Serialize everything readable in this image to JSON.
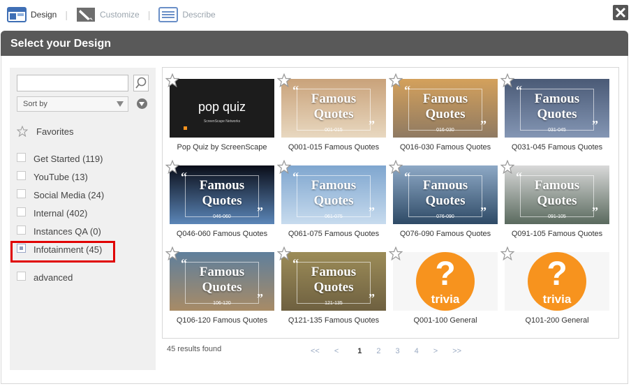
{
  "steps": [
    {
      "label": "Design",
      "icon": "layout-icon",
      "active": true
    },
    {
      "label": "Customize",
      "icon": "brush-icon",
      "active": false
    },
    {
      "label": "Describe",
      "icon": "describe-icon",
      "active": false
    }
  ],
  "header": {
    "title": "Select your Design"
  },
  "sidebar": {
    "search_placeholder": "",
    "sort_label": "Sort by",
    "favorites_label": "Favorites",
    "filters": [
      {
        "label": "Get Started (119)",
        "checked": false
      },
      {
        "label": "YouTube (13)",
        "checked": false
      },
      {
        "label": "Social Media (24)",
        "checked": false
      },
      {
        "label": "Internal (402)",
        "checked": false
      },
      {
        "label": "Instances QA (0)",
        "checked": false
      },
      {
        "label": "Infotainment (45)",
        "checked": true
      }
    ],
    "advanced_label": "advanced"
  },
  "designs": [
    {
      "caption": "Pop Quiz by ScreenScape",
      "kind": "popquiz",
      "thumb_title": "pop quiz",
      "thumb_sub": "ScreenScape Networks"
    },
    {
      "caption": "Q001-015 Famous Quotes",
      "kind": "quotes",
      "range": "001-015",
      "bg": [
        "#c9a27a",
        "#e8d8c0"
      ]
    },
    {
      "caption": "Q016-030 Famous Quotes",
      "kind": "quotes",
      "range": "016-030",
      "bg": [
        "#d4a15c",
        "#8f7a62"
      ]
    },
    {
      "caption": "Q031-045 Famous Quotes",
      "kind": "quotes",
      "range": "031-045",
      "bg": [
        "#4a5a76",
        "#8496b4"
      ]
    },
    {
      "caption": "Q046-060 Famous Quotes",
      "kind": "quotes",
      "range": "046-060",
      "bg": [
        "#0a0d18",
        "#5b86b8"
      ]
    },
    {
      "caption": "Q061-075 Famous Quotes",
      "kind": "quotes",
      "range": "061-075",
      "bg": [
        "#7fa6cf",
        "#c7dbee"
      ]
    },
    {
      "caption": "Q076-090 Famous Quotes",
      "kind": "quotes",
      "range": "076-090",
      "bg": [
        "#8ea9c6",
        "#2e4a66"
      ]
    },
    {
      "caption": "Q091-105 Famous Quotes",
      "kind": "quotes",
      "range": "091-105",
      "bg": [
        "#d9d9d9",
        "#5a6a5e"
      ]
    },
    {
      "caption": "Q106-120 Famous Quotes",
      "kind": "quotes",
      "range": "106-120",
      "bg": [
        "#5f7f9c",
        "#a88b66"
      ]
    },
    {
      "caption": "Q121-135 Famous Quotes",
      "kind": "quotes",
      "range": "121-135",
      "bg": [
        "#9c8c58",
        "#6e6040"
      ]
    },
    {
      "caption": "Q001-100 General",
      "kind": "trivia",
      "q": "?",
      "word": "trivia"
    },
    {
      "caption": "Q101-200 General",
      "kind": "trivia",
      "q": "?",
      "word": "trivia"
    }
  ],
  "quote_words": [
    "Famous",
    "Quotes"
  ],
  "results_text": "45 results found",
  "pagination": {
    "first": "<<",
    "prev": "<",
    "pages": [
      "1",
      "2",
      "3",
      "4"
    ],
    "current": "1",
    "next": ">",
    "last": ">>"
  },
  "colors": {
    "accent": "#f7931e",
    "highlight": "#e00000",
    "header_bg": "#595959"
  }
}
